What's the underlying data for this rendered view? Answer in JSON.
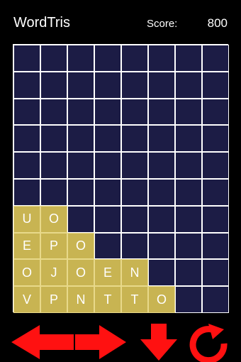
{
  "app": {
    "title": "WordTris"
  },
  "score": {
    "label": "Score:",
    "value": "800"
  },
  "board": {
    "columns": 8,
    "rows": 10,
    "empty_color": "#1c1c45",
    "tile_color": "#c8b452",
    "grid": [
      [
        "",
        "",
        "",
        "",
        "",
        "",
        "",
        ""
      ],
      [
        "",
        "",
        "",
        "",
        "",
        "",
        "",
        ""
      ],
      [
        "",
        "",
        "",
        "",
        "",
        "",
        "",
        ""
      ],
      [
        "",
        "",
        "",
        "",
        "",
        "",
        "",
        ""
      ],
      [
        "",
        "",
        "",
        "",
        "",
        "",
        "",
        ""
      ],
      [
        "",
        "",
        "",
        "",
        "",
        "",
        "",
        ""
      ],
      [
        "U",
        "O",
        "",
        "",
        "",
        "",
        "",
        ""
      ],
      [
        "E",
        "P",
        "O",
        "",
        "",
        "",
        "",
        ""
      ],
      [
        "O",
        "J",
        "O",
        "E",
        "N",
        "",
        "",
        ""
      ],
      [
        "V",
        "P",
        "N",
        "T",
        "T",
        "O",
        "",
        ""
      ]
    ],
    "filled": [
      [
        0,
        0,
        0,
        0,
        0,
        0,
        0,
        0
      ],
      [
        0,
        0,
        0,
        0,
        0,
        0,
        0,
        0
      ],
      [
        0,
        0,
        0,
        0,
        0,
        0,
        0,
        0
      ],
      [
        0,
        0,
        0,
        0,
        0,
        0,
        0,
        0
      ],
      [
        0,
        0,
        0,
        0,
        0,
        0,
        0,
        0
      ],
      [
        0,
        0,
        0,
        0,
        0,
        0,
        0,
        0
      ],
      [
        1,
        1,
        0,
        0,
        0,
        0,
        0,
        0
      ],
      [
        1,
        1,
        1,
        0,
        0,
        0,
        0,
        0
      ],
      [
        1,
        1,
        1,
        1,
        1,
        0,
        0,
        0
      ],
      [
        1,
        1,
        1,
        1,
        1,
        1,
        0,
        0
      ]
    ]
  },
  "controls": {
    "color": "#ff1111",
    "buttons": [
      {
        "name": "move-left-button",
        "icon": "arrow-left-icon"
      },
      {
        "name": "move-right-button",
        "icon": "arrow-right-icon"
      },
      {
        "name": "drop-button",
        "icon": "arrow-down-icon"
      },
      {
        "name": "rotate-button",
        "icon": "rotate-icon"
      }
    ]
  }
}
